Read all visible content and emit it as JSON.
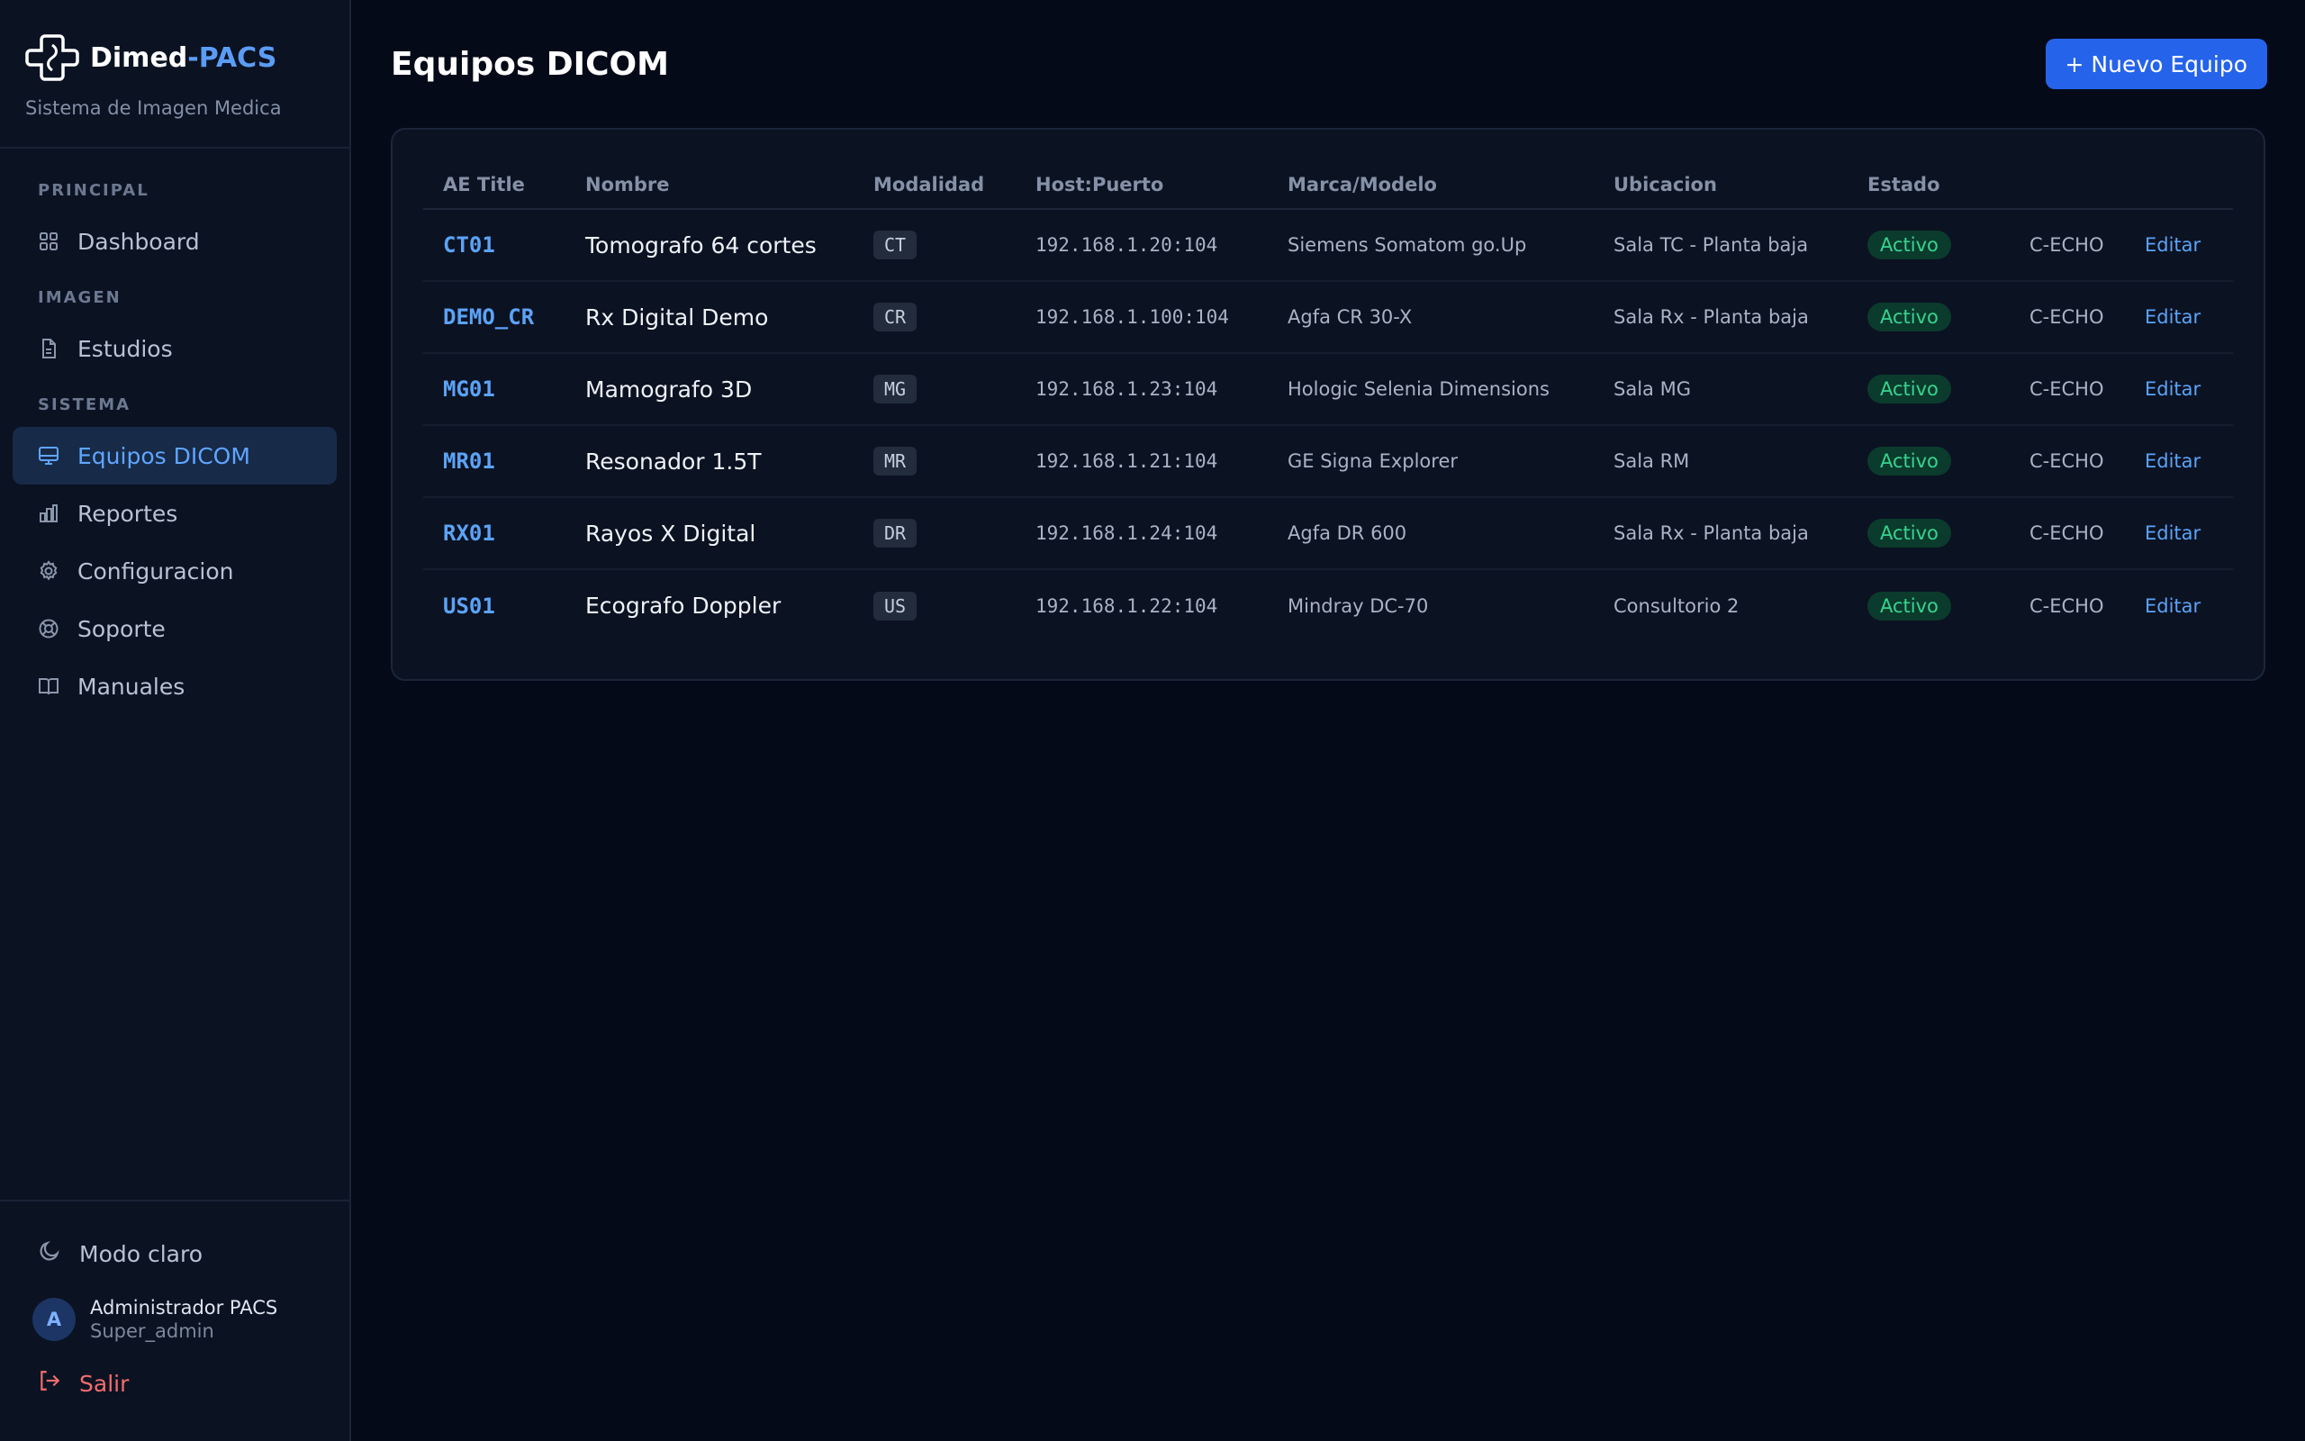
{
  "brand": {
    "name_main": "Dimed",
    "name_accent": "-PACS",
    "subtitle": "Sistema de Imagen Medica",
    "logo_icon": "medical-cross-logo"
  },
  "sidebar": {
    "sections": [
      {
        "label": "PRINCIPAL",
        "items": [
          {
            "label": "Dashboard",
            "icon": "grid-icon",
            "active": false
          }
        ]
      },
      {
        "label": "IMAGEN",
        "items": [
          {
            "label": "Estudios",
            "icon": "document-icon",
            "active": false
          }
        ]
      },
      {
        "label": "SISTEMA",
        "items": [
          {
            "label": "Equipos DICOM",
            "icon": "monitor-icon",
            "active": true
          },
          {
            "label": "Reportes",
            "icon": "bar-chart-icon",
            "active": false
          },
          {
            "label": "Configuracion",
            "icon": "gear-icon",
            "active": false
          },
          {
            "label": "Soporte",
            "icon": "lifebuoy-icon",
            "active": false
          },
          {
            "label": "Manuales",
            "icon": "book-icon",
            "active": false
          }
        ]
      }
    ],
    "mode_toggle": "Modo claro",
    "user": {
      "initial": "A",
      "name": "Administrador PACS",
      "role": "Super_admin"
    },
    "logout": "Salir"
  },
  "header": {
    "title": "Equipos DICOM",
    "new_button": "+ Nuevo Equipo"
  },
  "table": {
    "columns": [
      "AE Title",
      "Nombre",
      "Modalidad",
      "Host:Puerto",
      "Marca/Modelo",
      "Ubicacion",
      "Estado",
      "",
      ""
    ],
    "rows": [
      {
        "ae": "CT01",
        "nombre": "Tomografo 64 cortes",
        "modalidad": "CT",
        "host": "192.168.1.20:104",
        "marca": "Siemens Somatom go.Up",
        "ubicacion": "Sala TC - Planta baja",
        "estado": "Activo",
        "echo": "C-ECHO",
        "edit": "Editar"
      },
      {
        "ae": "DEMO_CR",
        "nombre": "Rx Digital Demo",
        "modalidad": "CR",
        "host": "192.168.1.100:104",
        "marca": "Agfa CR 30-X",
        "ubicacion": "Sala Rx - Planta baja",
        "estado": "Activo",
        "echo": "C-ECHO",
        "edit": "Editar"
      },
      {
        "ae": "MG01",
        "nombre": "Mamografo 3D",
        "modalidad": "MG",
        "host": "192.168.1.23:104",
        "marca": "Hologic Selenia Dimensions",
        "ubicacion": "Sala MG",
        "estado": "Activo",
        "echo": "C-ECHO",
        "edit": "Editar"
      },
      {
        "ae": "MR01",
        "nombre": "Resonador 1.5T",
        "modalidad": "MR",
        "host": "192.168.1.21:104",
        "marca": "GE Signa Explorer",
        "ubicacion": "Sala RM",
        "estado": "Activo",
        "echo": "C-ECHO",
        "edit": "Editar"
      },
      {
        "ae": "RX01",
        "nombre": "Rayos X Digital",
        "modalidad": "DR",
        "host": "192.168.1.24:104",
        "marca": "Agfa DR 600",
        "ubicacion": "Sala Rx - Planta baja",
        "estado": "Activo",
        "echo": "C-ECHO",
        "edit": "Editar"
      },
      {
        "ae": "US01",
        "nombre": "Ecografo Doppler",
        "modalidad": "US",
        "host": "192.168.1.22:104",
        "marca": "Mindray DC-70",
        "ubicacion": "Consultorio 2",
        "estado": "Activo",
        "echo": "C-ECHO",
        "edit": "Editar"
      }
    ]
  },
  "colors": {
    "background": "#050a18",
    "sidebar": "#0b1222",
    "accent": "#5ba3f6",
    "primary_button": "#2563eb",
    "status_active": "#37d391",
    "danger": "#f26d6d"
  }
}
